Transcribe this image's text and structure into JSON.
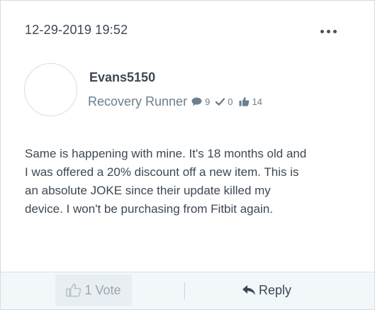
{
  "post": {
    "date": "12-29-2019 19:52",
    "author": {
      "username": "Evans5150",
      "rank": "Recovery Runner",
      "messages": "9",
      "solutions": "0",
      "kudos": "14"
    },
    "body": "Same is happening with mine.  It's 18 months old and\nI was offered a 20% discount off a new item.  This is\nan absolute JOKE since their update killed my\ndevice.  I won't be purchasing from Fitbit again."
  },
  "footer": {
    "vote_label": "1 Vote",
    "reply_label": "Reply"
  },
  "colors": {
    "text": "#3d4853",
    "muted": "#6b7f8e",
    "footer_bg": "#f2f8fa",
    "vote_bg": "#e8eef1"
  }
}
